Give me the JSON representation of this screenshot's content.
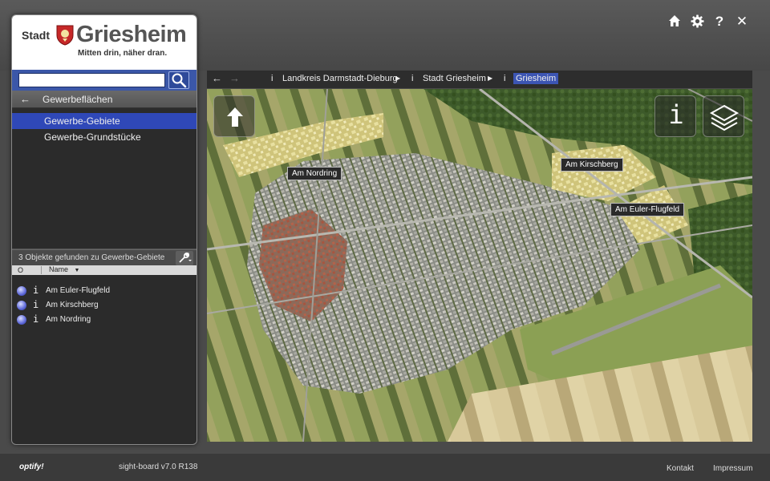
{
  "header": {
    "icons": [
      "home-icon",
      "gear-icon",
      "help-icon",
      "close-icon"
    ],
    "help_glyph": "?",
    "close_glyph": "✕"
  },
  "logo": {
    "prefix": "Stadt",
    "name": "Griesheim",
    "slogan": "Mitten drin, näher dran."
  },
  "search": {
    "value": "",
    "placeholder": ""
  },
  "nav": {
    "back_glyph": "←",
    "title": "Gewerbeflächen",
    "items": [
      {
        "label": "Gewerbe-Gebiete",
        "active": true
      },
      {
        "label": "Gewerbe-Grundstücke",
        "active": false
      }
    ]
  },
  "results": {
    "summary": "3 Objekte gefunden zu Gewerbe-Gebiete",
    "col_o": "O",
    "col_name": "Name",
    "sort_glyph": "▼",
    "info_glyph": "i",
    "items": [
      {
        "label": "Am Euler-Flugfeld"
      },
      {
        "label": "Am Kirschberg"
      },
      {
        "label": "Am Nordring"
      }
    ]
  },
  "breadcrumb": {
    "back_glyph": "←",
    "forward_glyph": "→",
    "info_glyph": "i",
    "items": [
      {
        "label": "Landkreis Darmstadt-Dieburg"
      },
      {
        "label": "Stadt Griesheim"
      },
      {
        "label": "Griesheim"
      }
    ]
  },
  "map": {
    "up_glyph": "↑",
    "info_glyph": "i",
    "labels": [
      "Am Nordring",
      "Am Kirschberg",
      "Am Euler-Flugfeld"
    ]
  },
  "footer": {
    "brand": "optify!",
    "version": "sight-board v7.0 R138",
    "contact": "Kontakt",
    "imprint": "Impressum"
  },
  "colors": {
    "accent": "#3c55b3",
    "search_bar": "#3b57a8",
    "active_item": "#2f48b8",
    "panel_bg": "#2b2b2b"
  }
}
